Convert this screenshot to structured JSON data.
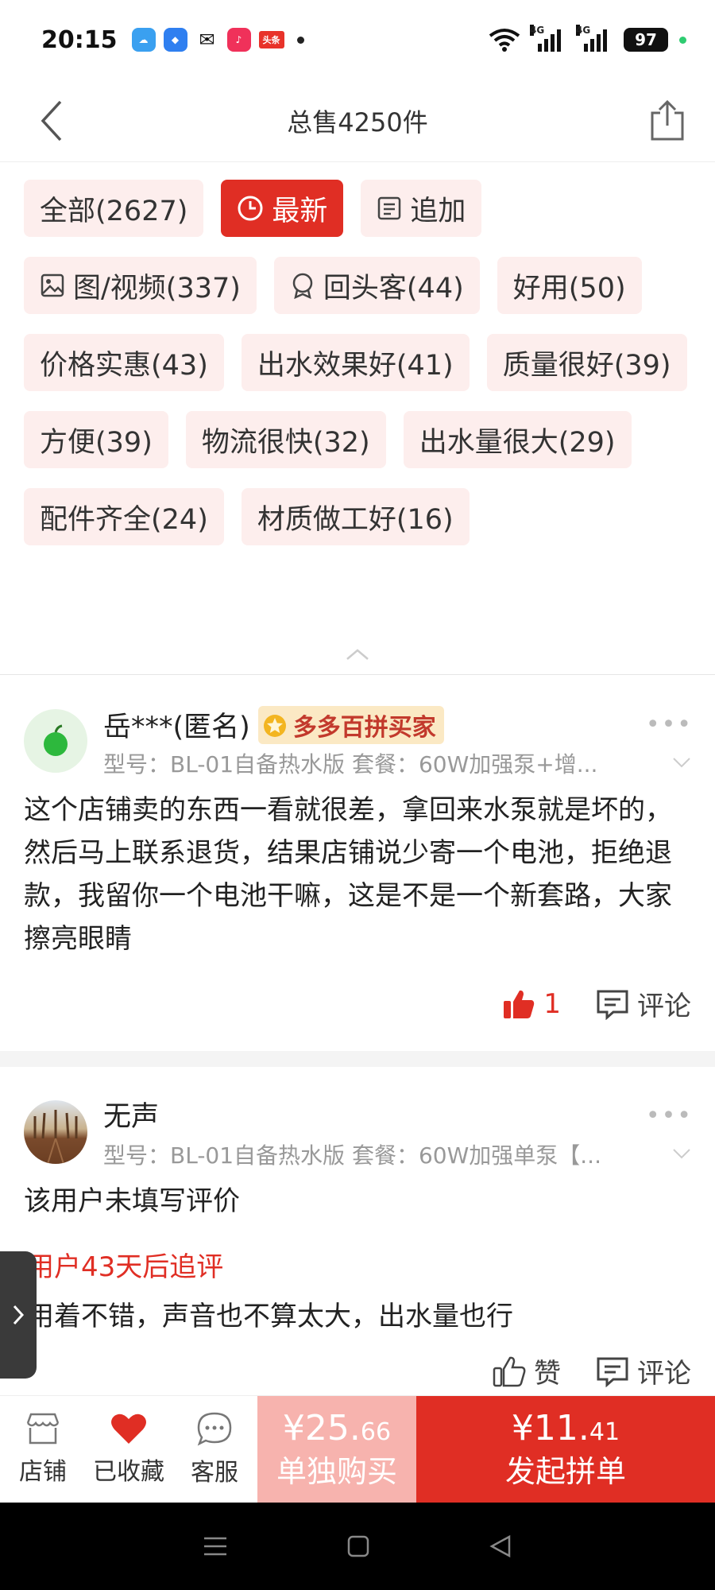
{
  "status_bar": {
    "time": "20:15",
    "app_badge_text": "头条",
    "signal1_label": "4G",
    "signal2_label": "4G",
    "battery": "97"
  },
  "header": {
    "title": "总售4250件"
  },
  "tags": [
    {
      "label": "全部(2627)",
      "icon": "",
      "active": false
    },
    {
      "label": "最新",
      "icon": "clock-icon",
      "active": true
    },
    {
      "label": "追加",
      "icon": "list-icon",
      "active": false
    },
    {
      "label": "图/视频(337)",
      "icon": "image-icon",
      "active": false
    },
    {
      "label": "回头客(44)",
      "icon": "medal-icon",
      "active": false
    },
    {
      "label": "好用(50)",
      "icon": "",
      "active": false
    },
    {
      "label": "价格实惠(43)",
      "icon": "",
      "active": false
    },
    {
      "label": "出水效果好(41)",
      "icon": "",
      "active": false
    },
    {
      "label": "质量很好(39)",
      "icon": "",
      "active": false
    },
    {
      "label": "方便(39)",
      "icon": "",
      "active": false
    },
    {
      "label": "物流很快(32)",
      "icon": "",
      "active": false
    },
    {
      "label": "出水量很大(29)",
      "icon": "",
      "active": false
    },
    {
      "label": "配件齐全(24)",
      "icon": "",
      "active": false
    },
    {
      "label": "材质做工好(16)",
      "icon": "",
      "active": false
    }
  ],
  "reviews": [
    {
      "username": "岳***(匿名)",
      "badge": "多多百拼买家",
      "spec": "型号：BL-01自备热水版 套餐：60W加强泵+增...",
      "content": "这个店铺卖的东西一看就很差，拿回来水泵就是坏的，然后马上联系退货，结果店铺说少寄一个电池，拒绝退款，我留你一个电池干嘛，这是不是一个新套路，大家擦亮眼睛",
      "like_count": "1",
      "comment_label": "评论"
    },
    {
      "username": "无声",
      "spec": "型号：BL-01自备热水版 套餐：60W加强单泵【...",
      "content": "该用户未填写评价",
      "followup_label": "用户43天后追评",
      "followup_text": "用着不错，声音也不算太大，出水量也行",
      "like_label": "赞",
      "comment_label": "评论"
    }
  ],
  "bottom_bar": {
    "store_label": "店铺",
    "favorite_label": "已收藏",
    "service_label": "客服",
    "single_price_main": "¥25.",
    "single_price_decimal": "66",
    "single_label": "单独购买",
    "group_price_main": "¥11.",
    "group_price_decimal": "41",
    "group_label": "发起拼单"
  },
  "colors": {
    "accent": "#e02e24",
    "tag_bg": "#fdeeed",
    "single_bg": "#f7b3ae",
    "badge_bg": "#fbe9c4"
  }
}
